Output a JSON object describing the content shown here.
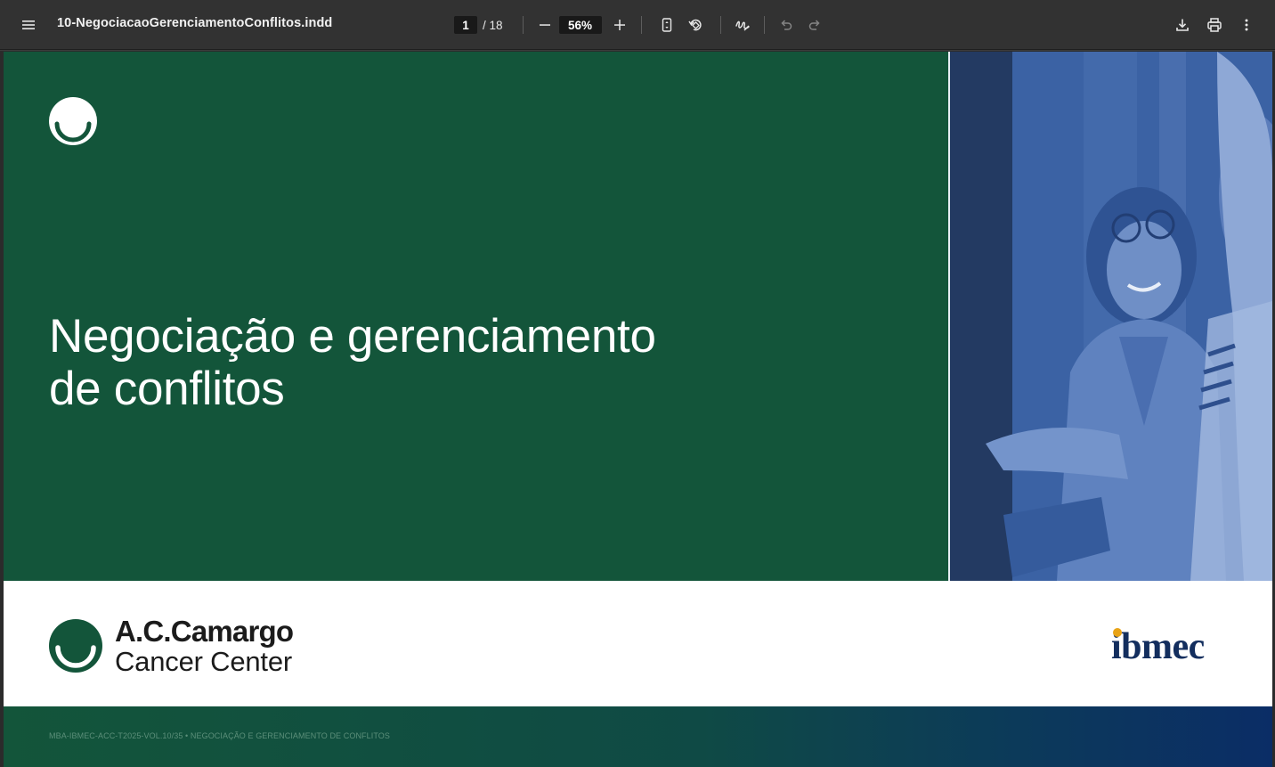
{
  "toolbar": {
    "document_title": "10-NegociacaoGerenciamentoConflitos.indd",
    "current_page": "1",
    "total_pages": "/ 18",
    "zoom": "56%",
    "icons": [
      "menu-icon",
      "zoom-out-icon",
      "zoom-in-icon",
      "fit-page-icon",
      "rotate-icon",
      "annotate-icon",
      "undo-icon",
      "redo-icon",
      "download-icon",
      "print-icon",
      "more-options-icon"
    ]
  },
  "page": {
    "title_line1": "Negociação e gerenciamento",
    "title_line2": "de conflitos",
    "logo_primary_name": "A.C.Camargo",
    "logo_primary_sub": "Cancer Center",
    "logo_secondary": "ibmec",
    "footer": "MBA-IBMEC-ACC-T2025-VOL.10/35 • NEGOCIAÇÃO E GERENCIAMENTO DE CONFLITOS",
    "colors": {
      "green": "#13553a",
      "photo_blue": "#3a62a4",
      "ibmec_navy": "#132e5e",
      "ibmec_dot": "#e8a317"
    }
  }
}
